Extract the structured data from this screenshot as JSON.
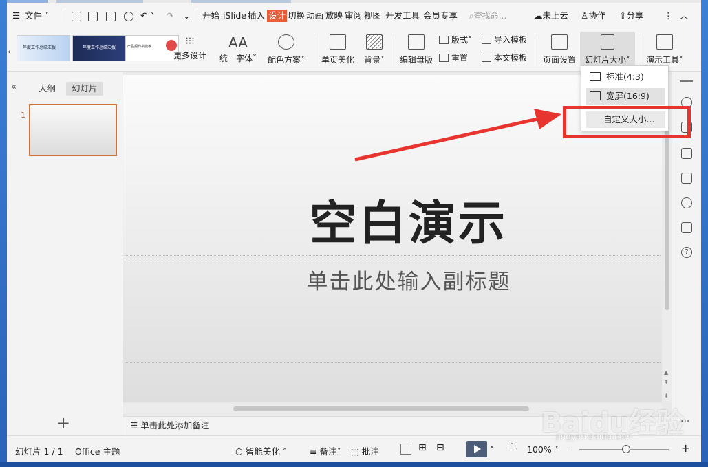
{
  "menubar": {
    "file": "文件",
    "tabs": [
      "开始",
      "iSlide",
      "插入",
      "设计",
      "切换",
      "动画",
      "放映",
      "审阅",
      "视图",
      "开发工具",
      "会员专享"
    ],
    "active_tab": "设计",
    "search": "查找命...",
    "cloud": "未上云",
    "collab": "协作",
    "share": "分享"
  },
  "ribbon": {
    "more_designs": "更多设计",
    "unify_font": "统一字体",
    "color_scheme": "配色方案",
    "page_beautify": "单页美化",
    "background": "背景",
    "edit_master": "编辑母版",
    "layout": "版式",
    "reset": "重置",
    "import_template": "导入模板",
    "text_template": "本文模板",
    "page_setup": "页面设置",
    "slide_size": "幻灯片大小",
    "presentation_tools": "演示工具",
    "theme_thumbs": [
      "年度工作总结汇报",
      "年度工作总结汇报",
      "产品契约书模板"
    ]
  },
  "left_panel": {
    "tab_outline": "大纲",
    "tab_slides": "幻灯片",
    "slide_number": "1"
  },
  "slide": {
    "title": "空白演示",
    "subtitle": "单击此处输入副标题"
  },
  "notes": "单击此处添加备注",
  "dropdown": {
    "standard": "标准(4:3)",
    "widescreen": "宽屏(16:9)",
    "custom": "自定义大小..."
  },
  "status": {
    "slide_count": "幻灯片 1 / 1",
    "theme": "Office 主题",
    "smart_beautify": "智能美化",
    "notes": "备注",
    "comments": "批注",
    "zoom": "100%"
  },
  "watermark": {
    "brand": "Baidu经验",
    "url": "jingyan.baidu.com"
  },
  "colors": {
    "accent_tab": "#ea5c35",
    "highlight_box": "#e8342f",
    "play_button": "#4f5e78"
  }
}
